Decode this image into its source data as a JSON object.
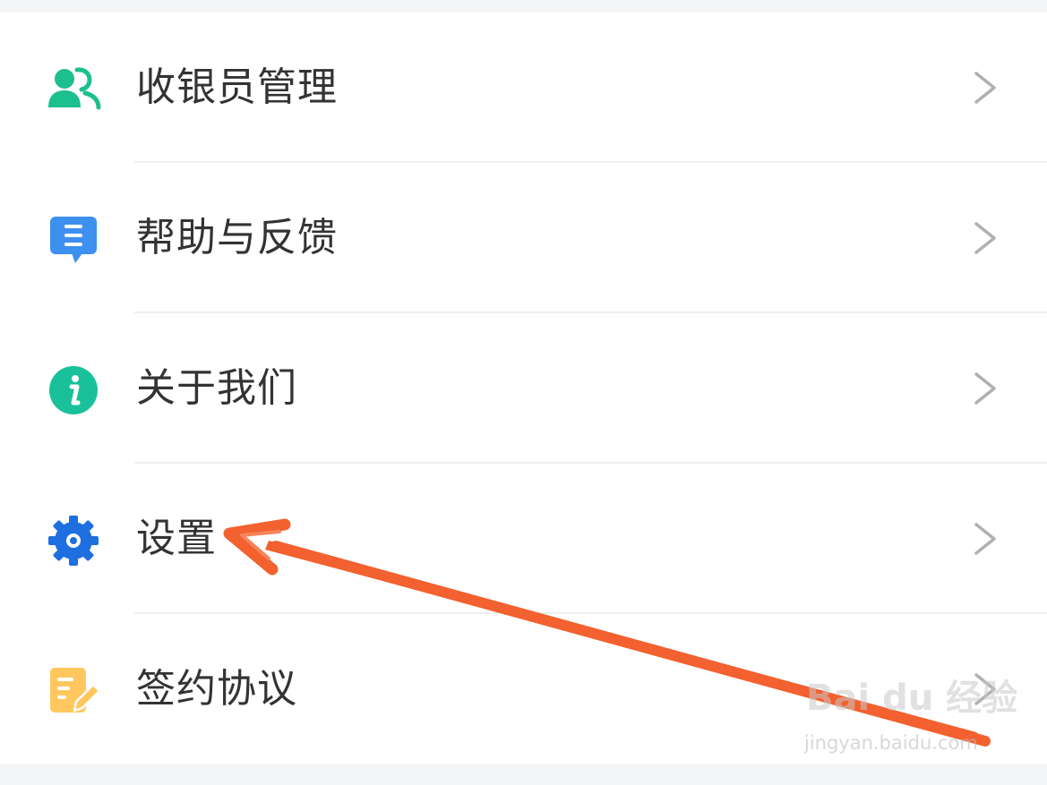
{
  "menu": {
    "items": [
      {
        "label": "收银员管理",
        "icon": "users-icon",
        "icon_color": "#1cbf8e"
      },
      {
        "label": "帮助与反馈",
        "icon": "message-icon",
        "icon_color": "#3d8ff0"
      },
      {
        "label": "关于我们",
        "icon": "info-icon",
        "icon_color": "#19c19a"
      },
      {
        "label": "设置",
        "icon": "gear-icon",
        "icon_color": "#1e6fe0"
      },
      {
        "label": "签约协议",
        "icon": "document-icon",
        "icon_color": "#ffc75e"
      }
    ]
  },
  "colors": {
    "background": "#f4f5f7",
    "card": "#ffffff",
    "text": "#333333",
    "chevron": "#b0b0b0",
    "annotation_arrow": "#f2612f"
  },
  "watermark": {
    "logo": "Bai du 经验",
    "url": "jingyan.baidu.com"
  }
}
